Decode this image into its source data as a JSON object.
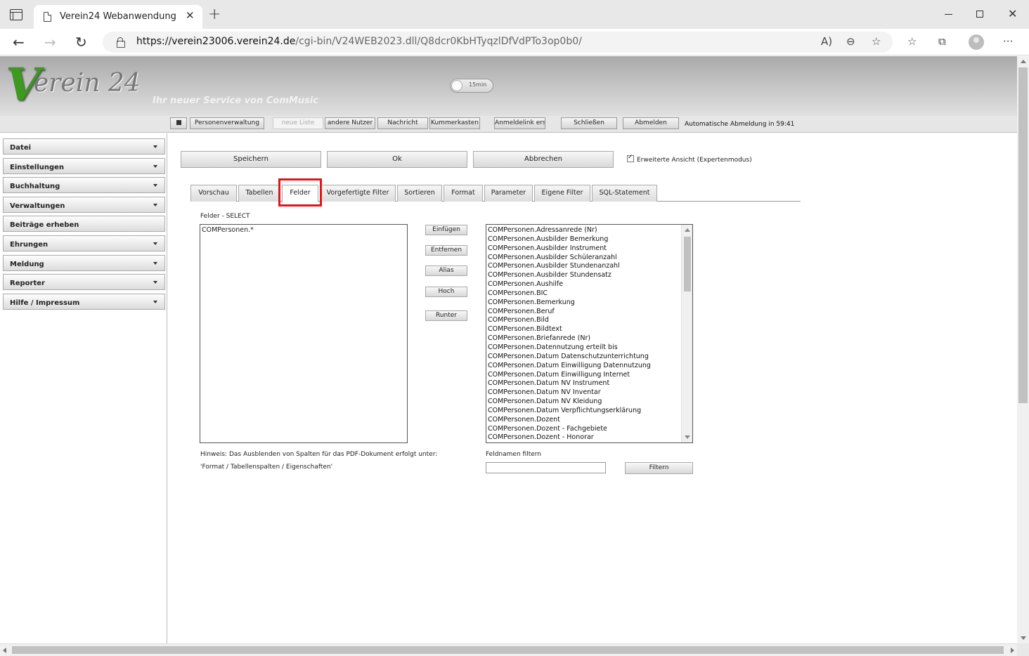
{
  "browser": {
    "tab_title": "Verein24 Webanwendung",
    "close_glyph": "✕",
    "newtab_glyph": "+",
    "url_host": "https://verein23006.verein24.de",
    "url_path": "/cgi-bin/V24WEB2023.dll/Q8dcr0KbHTyqzlDfVdPTo3op0b0/"
  },
  "header": {
    "logo_v": "V",
    "logo_text": "erein 24",
    "slogan": "Ihr neuer Service von ComMusic",
    "timer_label": "15min"
  },
  "topbar": {
    "personenverwaltung": "Personenverwaltung",
    "neue_liste": "neue Liste",
    "andere_nutzer": "andere Nutzer",
    "nachricht": "Nachricht",
    "kummerkasten": "Kummerkasten",
    "anmeldelink": "Anmeldelink erst",
    "schliessen": "Schließen",
    "abmelden": "Abmelden",
    "auto_logout": "Automatische Abmeldung in 59:41"
  },
  "sidebar": {
    "items": [
      {
        "label": "Datei"
      },
      {
        "label": "Einstellungen"
      },
      {
        "label": "Buchhaltung"
      },
      {
        "label": "Verwaltungen"
      },
      {
        "label": "Beiträge erheben"
      },
      {
        "label": "Ehrungen"
      },
      {
        "label": "Meldung"
      },
      {
        "label": "Reporter"
      },
      {
        "label": "Hilfe / Impressum"
      }
    ]
  },
  "actions": {
    "speichern": "Speichern",
    "ok": "Ok",
    "abbrechen": "Abbrechen",
    "expert_label": "Erweiterte Ansicht (Expertenmodus)"
  },
  "tabs": [
    {
      "label": "Vorschau"
    },
    {
      "label": "Tabellen"
    },
    {
      "label": "Felder"
    },
    {
      "label": "Vorgefertigte Filter"
    },
    {
      "label": "Sortieren"
    },
    {
      "label": "Format"
    },
    {
      "label": "Parameter"
    },
    {
      "label": "Eigene Filter"
    },
    {
      "label": "SQL-Statement"
    }
  ],
  "felder": {
    "select_label": "Felder - SELECT",
    "selected_value": "COMPersonen.*",
    "btn_einfuegen": "Einfügen",
    "btn_entfernen": "Entfernen",
    "btn_alias": "Alias",
    "btn_hoch": "Hoch",
    "btn_runter": "Runter",
    "hint_line1": "Hinweis: Das Ausblenden von Spalten für das PDF-Dokument erfolgt unter:",
    "hint_line2": "'Format / Tabellenspalten / Eigenschaften'",
    "filter_label": "Feldnamen filtern",
    "filter_value": "",
    "btn_filtern": "Filtern",
    "available_fields": [
      "COMPersonen.Adressanrede (Nr)",
      "COMPersonen.Ausbilder Bemerkung",
      "COMPersonen.Ausbilder Instrument",
      "COMPersonen.Ausbilder Schüleranzahl",
      "COMPersonen.Ausbilder Stundenanzahl",
      "COMPersonen.Ausbilder Stundensatz",
      "COMPersonen.Aushilfe",
      "COMPersonen.BIC",
      "COMPersonen.Bemerkung",
      "COMPersonen.Beruf",
      "COMPersonen.Bild",
      "COMPersonen.Bildtext",
      "COMPersonen.Briefanrede (Nr)",
      "COMPersonen.Datennutzung erteilt bis",
      "COMPersonen.Datum Datenschutzunterrichtung",
      "COMPersonen.Datum Einwilligung Datennutzung",
      "COMPersonen.Datum Einwilligung Internet",
      "COMPersonen.Datum NV Instrument",
      "COMPersonen.Datum NV Inventar",
      "COMPersonen.Datum NV Kleidung",
      "COMPersonen.Datum Verpflichtungserklärung",
      "COMPersonen.Dozent",
      "COMPersonen.Dozent - Fachgebiete",
      "COMPersonen.Dozent - Honorar"
    ]
  }
}
